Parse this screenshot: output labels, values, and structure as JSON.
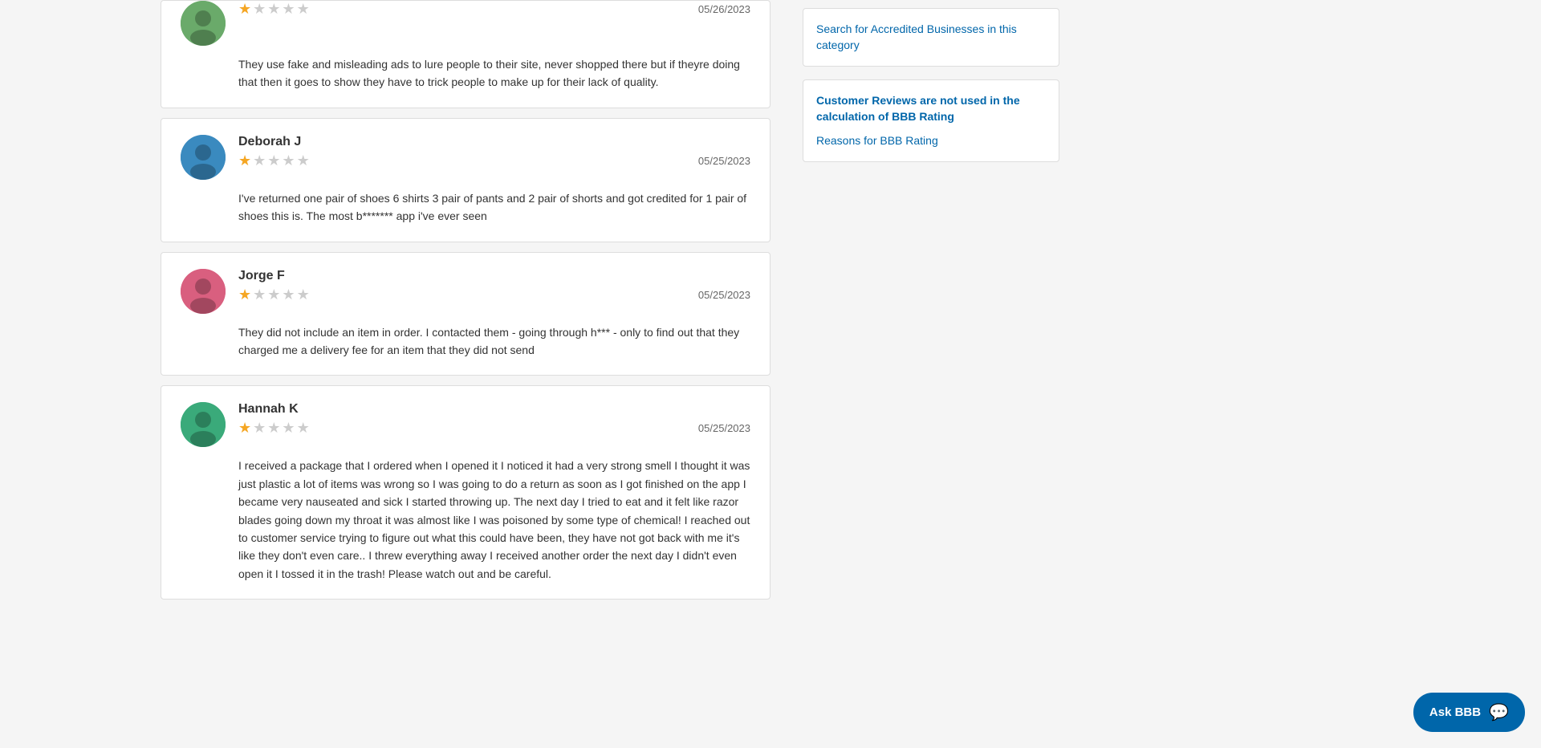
{
  "reviews": [
    {
      "id": "review-partial",
      "name": "",
      "avatar_color": "#6aaa6a",
      "date": "05/26/2023",
      "rating": 1,
      "max_rating": 5,
      "text": "They use fake and misleading ads to lure people to their site, never shopped there but if theyre doing that then it goes to show they have to trick people to make up for their lack of quality."
    },
    {
      "id": "review-deborah",
      "name": "Deborah J",
      "avatar_color": "#3a8abf",
      "date": "05/25/2023",
      "rating": 1,
      "max_rating": 5,
      "text": "I've returned one pair of shoes 6 shirts 3 pair of pants and 2 pair of shorts and got credited for 1 pair of shoes this is. The most b******* app i've ever seen"
    },
    {
      "id": "review-jorge",
      "name": "Jorge F",
      "avatar_color": "#d95f7f",
      "date": "05/25/2023",
      "rating": 1,
      "max_rating": 5,
      "text": "They did not include an item in order. I contacted them - going through h*** - only to find out that they charged me a delivery fee for an item that they did not send"
    },
    {
      "id": "review-hannah",
      "name": "Hannah K",
      "avatar_color": "#3aaa7a",
      "date": "05/25/2023",
      "rating": 1,
      "max_rating": 5,
      "text": "I received a package that I ordered when I opened it I noticed it had a very strong smell I thought it was just plastic a lot of items was wrong so I was going to do a return as soon as I got finished on the app I became very nauseated and sick I started throwing up. The next day I tried to eat and it felt like razor blades going down my throat it was almost like I was poisoned by some type of chemical! I reached out to customer service trying to figure out what this could have been, they have not got back with me it's like they don't even care.. I threw everything away I received another order the next day I didn't even open it I tossed it in the trash! Please watch out and be careful."
    }
  ],
  "sidebar": {
    "search_link_text": "Search for Accredited Businesses in this category",
    "note_text": "Customer Reviews are not used in the calculation of BBB Rating",
    "reasons_link_text": "Reasons for BBB Rating"
  },
  "ask_bbb": {
    "label": "Ask BBB"
  }
}
